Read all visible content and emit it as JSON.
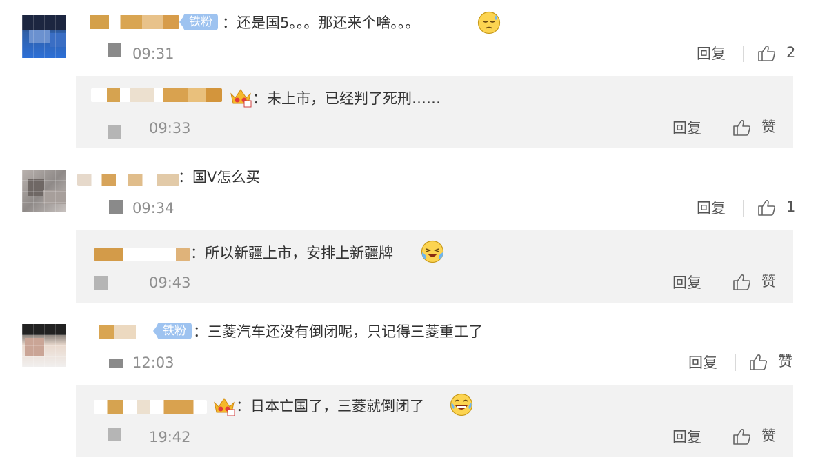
{
  "comments": [
    {
      "tag": "铁粉",
      "text": "：还是国5。。。那还来个啥。。。",
      "emoji": "sleepy-sweat-face",
      "time": "09:31",
      "reply_label": "回复",
      "like_label": "2"
    },
    {
      "text": "：国V怎么买",
      "time": "09:34",
      "reply_label": "回复",
      "like_label": "1"
    },
    {
      "tag": "铁粉",
      "text": "：三菱汽车还没有倒闭呢，只记得三菱重工了",
      "time": "12:03",
      "reply_label": "回复",
      "like_label": "赞"
    }
  ],
  "replies": [
    {
      "badge": "crown-badge",
      "text": "：未上市，已经判了死刑……",
      "time": "09:33",
      "reply_label": "回复",
      "like_label": "赞"
    },
    {
      "text": "：所以新疆上市，安排上新疆牌",
      "emoji": "laughing-tears-face",
      "time": "09:43",
      "reply_label": "回复",
      "like_label": "赞"
    },
    {
      "badge": "crown-badge",
      "text": "：日本亡国了，三菱就倒闭了",
      "emoji": "grinning-tears-face",
      "time": "19:42",
      "reply_label": "回复",
      "like_label": "赞"
    }
  ],
  "colors": {
    "tag_bg": "#9ec3f0",
    "reply_bg": "#f2f2f2",
    "time": "#8f8f8f",
    "text": "#333333"
  }
}
